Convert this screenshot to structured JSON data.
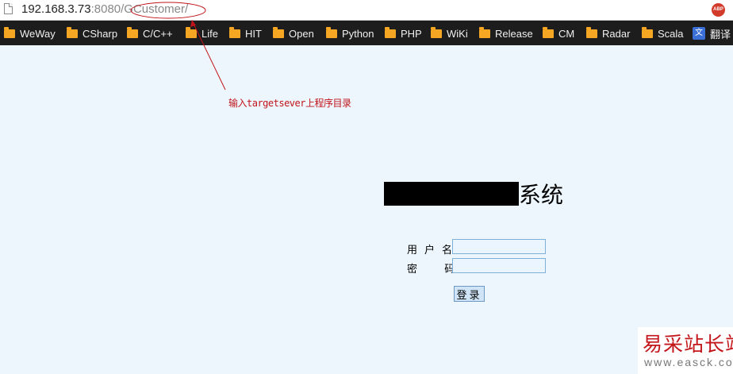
{
  "address_bar": {
    "host": "192.168.3.73",
    "port": ":8080",
    "path": "/GCustomer/",
    "extension_badge": "ABP"
  },
  "bookmarks": [
    {
      "label": "WeWay",
      "icon": "folder-icon"
    },
    {
      "label": "CSharp",
      "icon": "folder-icon"
    },
    {
      "label": "C/C++",
      "icon": "folder-icon"
    },
    {
      "label": "Life",
      "icon": "folder-icon"
    },
    {
      "label": "HIT",
      "icon": "folder-icon"
    },
    {
      "label": "Open",
      "icon": "folder-icon"
    },
    {
      "label": "Python",
      "icon": "folder-icon"
    },
    {
      "label": "PHP",
      "icon": "folder-icon"
    },
    {
      "label": "WiKi",
      "icon": "folder-icon"
    },
    {
      "label": "Release",
      "icon": "folder-icon"
    },
    {
      "label": "CM",
      "icon": "folder-icon"
    },
    {
      "label": "Radar",
      "icon": "folder-icon"
    },
    {
      "label": "Scala",
      "icon": "folder-icon"
    },
    {
      "label": "翻译",
      "icon": "translate-icon"
    }
  ],
  "annotation": {
    "text": "输入targetsever上程序目录",
    "color": "#c0141a"
  },
  "login": {
    "title_suffix": "系统",
    "username_label": "用户名",
    "username_value": "",
    "password_label": "密  码",
    "password_value": "",
    "submit_label": "登录"
  },
  "watermark": {
    "title": "易采站长站",
    "domain": "www.easck.com"
  },
  "colors": {
    "page_background": "#eef6fd",
    "bookmark_bar": "#1d1d1d",
    "folder": "#f5a623",
    "watermark_red": "#c2161b"
  }
}
